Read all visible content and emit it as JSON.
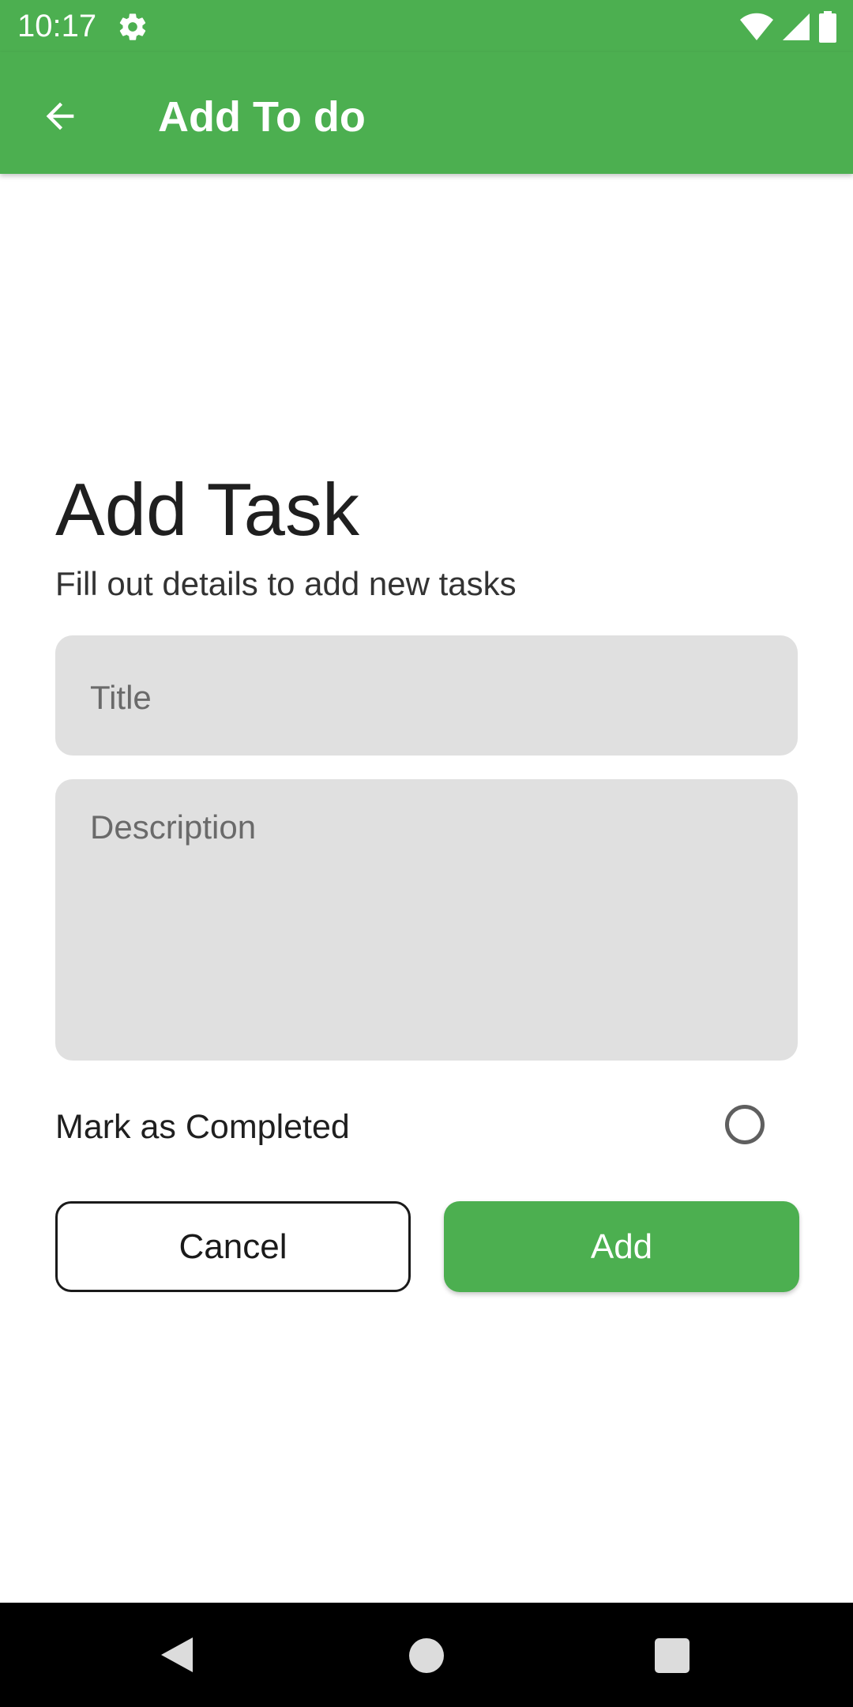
{
  "status_bar": {
    "time": "10:17",
    "icons": [
      "gear-icon",
      "wifi-icon",
      "signal-icon",
      "battery-icon"
    ]
  },
  "app_bar": {
    "title": "Add To do",
    "back_icon": "arrow-left-icon",
    "color": "#4caf50"
  },
  "form": {
    "heading": "Add Task",
    "subheading": "Fill out details to add new tasks",
    "title_placeholder": "Title",
    "description_placeholder": "Description",
    "mark_completed_label": "Mark as Completed",
    "mark_completed_checked": false,
    "cancel_label": "Cancel",
    "add_label": "Add"
  },
  "nav_bar": {
    "icons": [
      "back-triangle-icon",
      "home-circle-icon",
      "recents-square-icon"
    ]
  },
  "colors": {
    "accent": "#4caf50",
    "field_background": "#e0e0e0"
  }
}
